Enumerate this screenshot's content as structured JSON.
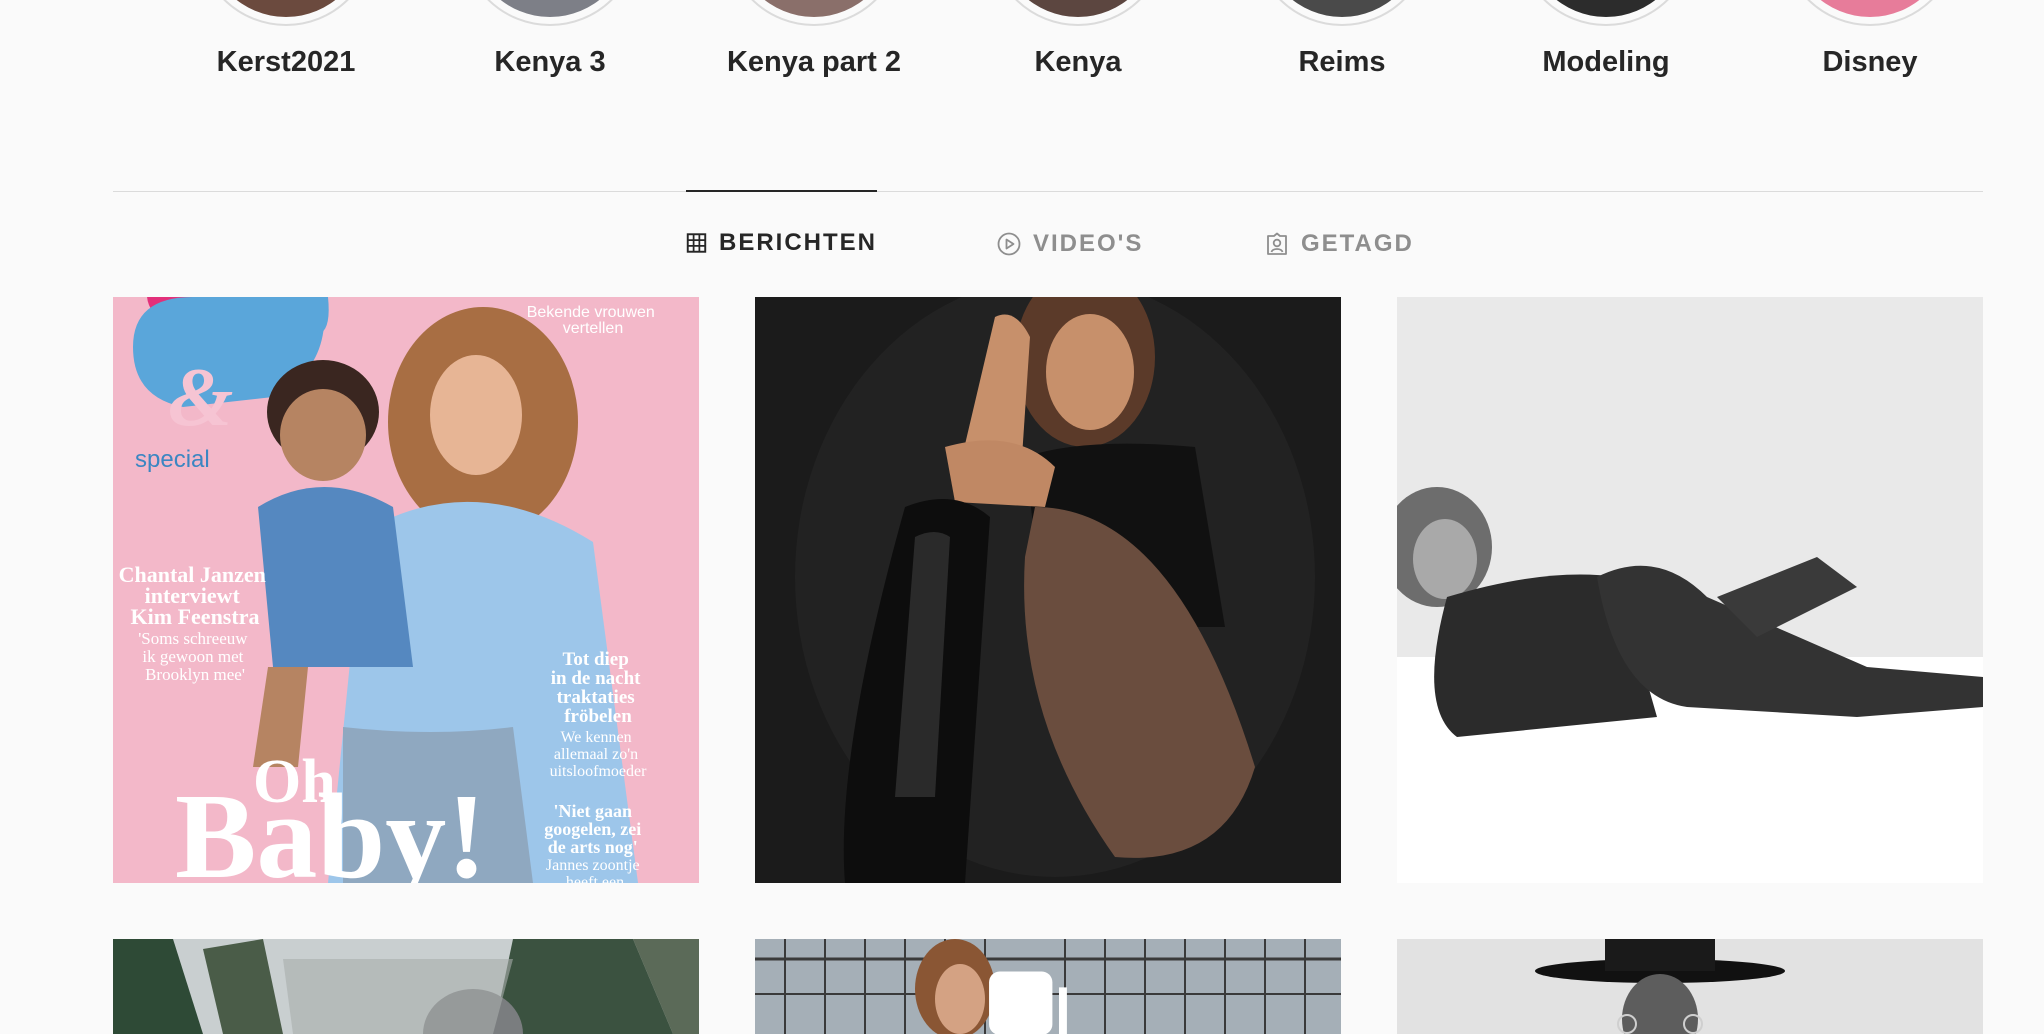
{
  "highlights": [
    {
      "label": "Kerst2021"
    },
    {
      "label": "Kenya 3"
    },
    {
      "label": "Kenya part 2"
    },
    {
      "label": "Kenya"
    },
    {
      "label": "Reims"
    },
    {
      "label": "Modeling"
    },
    {
      "label": "Disney"
    }
  ],
  "tabs": {
    "posts": "BERICHTEN",
    "videos": "VIDEO'S",
    "tagged": "GETAGD"
  },
  "magazine_cover": {
    "brand_symbol": "&",
    "special": "special",
    "top_right": [
      "Bekende vrouwen",
      "vertellen"
    ],
    "left_headline": [
      "Chantal Janzen",
      "interviewt",
      "Kim Feenstra"
    ],
    "left_sub": [
      "'Soms schreeuw",
      "ik gewoon met",
      "Brooklyn mee'"
    ],
    "right_headline": [
      "Tot diep",
      "in de nacht",
      "traktaties",
      "fröbelen"
    ],
    "right_sub": [
      "We kennen",
      "allemaal zo'n",
      "uitsloofmoeder"
    ],
    "bottom_right": [
      "'Niet gaan",
      "googelen, zei",
      "de arts nog'",
      "Jannes zoontje",
      "heeft een"
    ],
    "big_title_1": "Oh",
    "big_title_2": "Baby!"
  },
  "colors": {
    "accent_text": "#262626",
    "muted_text": "#8e8e8e",
    "cover_pink": "#f4b6c8",
    "cover_blue": "#5aa6da"
  }
}
